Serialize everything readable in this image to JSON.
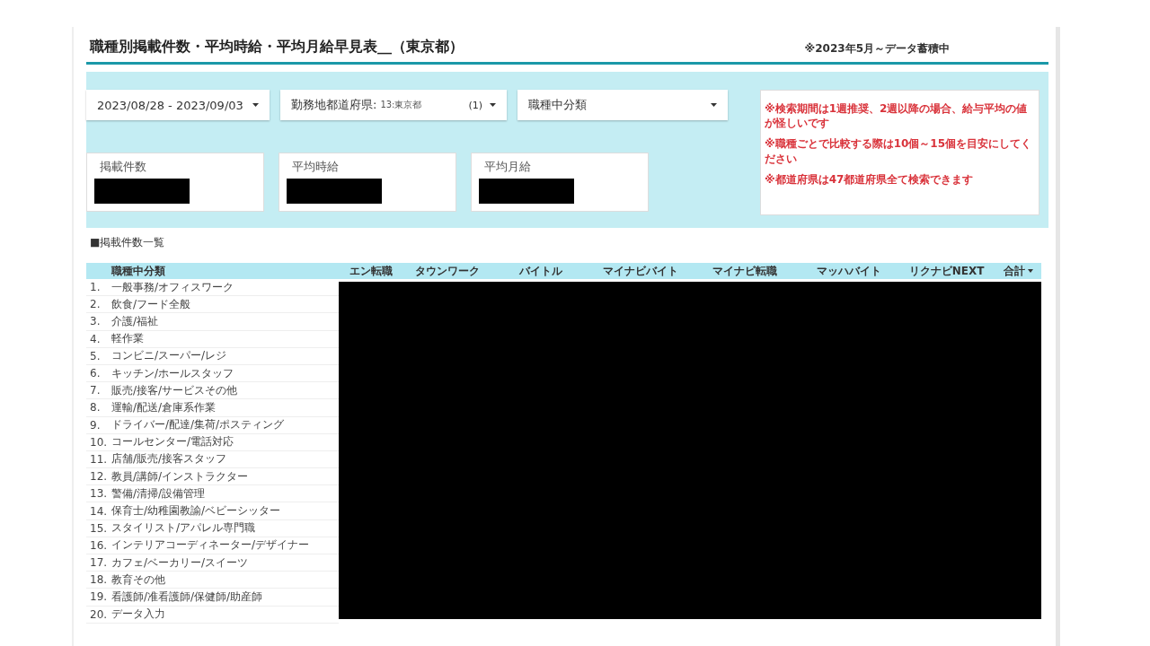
{
  "header": {
    "title": "職種別掲載件数・平均時給・平均月給早見表__（東京都）",
    "note": "※2023年5月～データ蓄積中"
  },
  "filters": [
    {
      "kind": "date",
      "value": "2023/08/28 - 2023/09/03"
    },
    {
      "kind": "select",
      "label": "勤務地都道府県:",
      "value": "13:東京都",
      "count": "(1)"
    },
    {
      "kind": "select",
      "label": "職種中分類"
    }
  ],
  "notices": [
    "※検索期間は1週推奨、2週以降の場合、給与平均の値が怪しいです",
    "※職種ごとで比較する際は10個～15個を目安にしてください",
    "※都道府県は47都道府県全て検索できます"
  ],
  "metrics": [
    {
      "label": "掲載件数"
    },
    {
      "label": "平均時給"
    },
    {
      "label": "平均月給"
    }
  ],
  "section_title": "■掲載件数一覧",
  "table": {
    "columns": [
      {
        "label": "職種中分類",
        "sorted": false
      },
      {
        "label": "エン転職",
        "sorted": false
      },
      {
        "label": "タウンワーク",
        "sorted": false
      },
      {
        "label": "バイトル",
        "sorted": false
      },
      {
        "label": "マイナビバイト",
        "sorted": false
      },
      {
        "label": "マイナビ転職",
        "sorted": false
      },
      {
        "label": "マッハバイト",
        "sorted": false
      },
      {
        "label": "リクナビNEXT",
        "sorted": false
      },
      {
        "label": "合計",
        "sorted": true
      }
    ],
    "rows": [
      {
        "index": "1.",
        "name": "一般事務/オフィスワーク"
      },
      {
        "index": "2.",
        "name": "飲食/フード全般"
      },
      {
        "index": "3.",
        "name": "介護/福祉"
      },
      {
        "index": "4.",
        "name": "軽作業"
      },
      {
        "index": "5.",
        "name": "コンビニ/スーパー/レジ"
      },
      {
        "index": "6.",
        "name": "キッチン/ホールスタッフ"
      },
      {
        "index": "7.",
        "name": "販売/接客/サービスその他"
      },
      {
        "index": "8.",
        "name": "運輸/配送/倉庫系作業"
      },
      {
        "index": "9.",
        "name": "ドライバー/配達/集荷/ポスティング"
      },
      {
        "index": "10.",
        "name": "コールセンター/電話対応"
      },
      {
        "index": "11.",
        "name": "店舗/販売/接客スタッフ"
      },
      {
        "index": "12.",
        "name": "教員/講師/インストラクター"
      },
      {
        "index": "13.",
        "name": "警備/清掃/設備管理"
      },
      {
        "index": "14.",
        "name": "保育士/幼稚園教諭/ベビーシッター"
      },
      {
        "index": "15.",
        "name": "スタイリスト/アパレル専門職"
      },
      {
        "index": "16.",
        "name": "インテリアコーディネーター/デザイナー"
      },
      {
        "index": "17.",
        "name": "カフェ/ベーカリー/スイーツ"
      },
      {
        "index": "18.",
        "name": "教育その他"
      },
      {
        "index": "19.",
        "name": "看護師/准看護師/保健師/助産師"
      },
      {
        "index": "20.",
        "name": "データ入力"
      }
    ]
  }
}
